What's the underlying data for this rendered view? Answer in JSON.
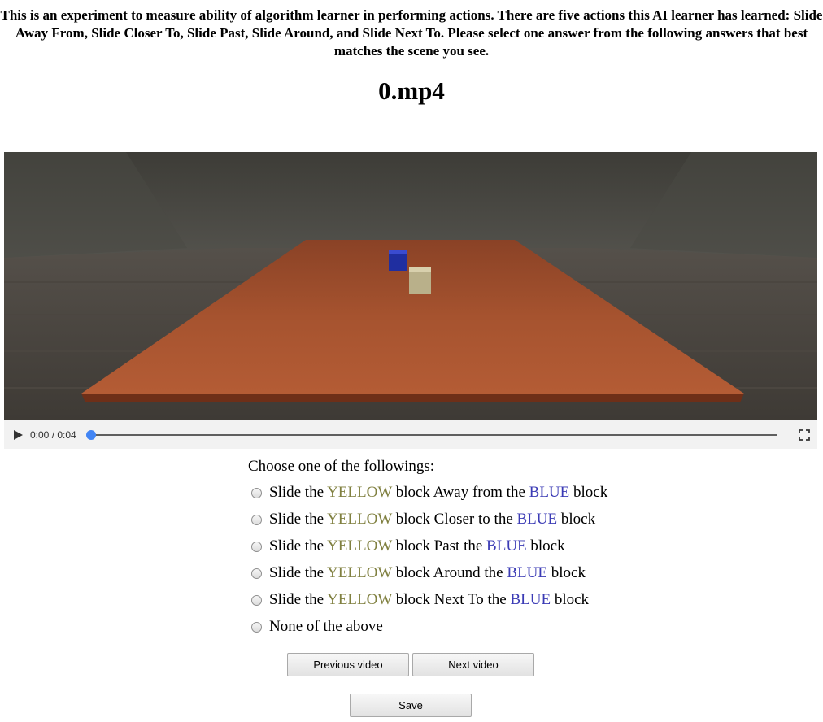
{
  "instructions": "This is an experiment to measure ability of algorithm learner in performing actions. There are five actions this AI learner has learned: Slide Away From, Slide Closer To, Slide Past, Slide Around, and Slide Next To. Please select one answer from the following answers that best matches the scene you see.",
  "video": {
    "title": "0.mp4",
    "time_display": "0:00 / 0:04",
    "progress": 0,
    "play_icon": "play-icon",
    "fullscreen_icon": "fullscreen-icon"
  },
  "question": "Choose one of the followings:",
  "options": [
    {
      "prefix": "Slide the ",
      "color1": "YELLOW",
      "middle": " block Away from the ",
      "color2": "BLUE",
      "suffix": " block"
    },
    {
      "prefix": "Slide the ",
      "color1": "YELLOW",
      "middle": " block Closer to the ",
      "color2": "BLUE",
      "suffix": " block"
    },
    {
      "prefix": "Slide the ",
      "color1": "YELLOW",
      "middle": " block Past the ",
      "color2": "BLUE",
      "suffix": " block"
    },
    {
      "prefix": "Slide the ",
      "color1": "YELLOW",
      "middle": " block Around the ",
      "color2": "BLUE",
      "suffix": " block"
    },
    {
      "prefix": "Slide the ",
      "color1": "YELLOW",
      "middle": " block Next To the ",
      "color2": "BLUE",
      "suffix": " block"
    },
    {
      "prefix": "None of the above",
      "color1": "",
      "middle": "",
      "color2": "",
      "suffix": ""
    }
  ],
  "buttons": {
    "previous": "Previous video",
    "next": "Next video",
    "save": "Save"
  },
  "colors": {
    "yellow_word": "#808040",
    "blue_word": "#3b3bb5",
    "seek_accent": "#4285f4"
  }
}
